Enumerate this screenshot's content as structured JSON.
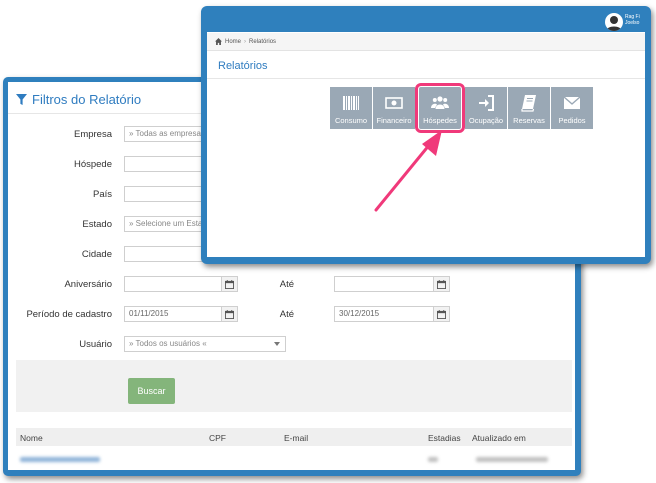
{
  "filters": {
    "title": "Filtros do Relatório",
    "fields": {
      "empresa": {
        "label": "Empresa",
        "value": "» Todas as empresas"
      },
      "hospede": {
        "label": "Hóspede",
        "value": ""
      },
      "pais": {
        "label": "País",
        "value": ""
      },
      "estado": {
        "label": "Estado",
        "value": "» Selecione um Esta"
      },
      "cidade": {
        "label": "Cidade",
        "value": ""
      },
      "aniversario": {
        "label": "Aniversário",
        "value": "",
        "ate_label": "Até",
        "ate_value": ""
      },
      "periodo": {
        "label": "Período de cadastro",
        "value": "01/11/2015",
        "ate_label": "Até",
        "ate_value": "30/12/2015"
      },
      "usuario": {
        "label": "Usuário",
        "value": "» Todos os usuários «"
      }
    },
    "search_button": "Buscar"
  },
  "table": {
    "columns": [
      "Nome",
      "CPF",
      "E-mail",
      "Estadias",
      "Atualizado em"
    ]
  },
  "reports": {
    "user_name_line1": "Rag Fi",
    "user_name_line2": "Joelso",
    "breadcrumb": {
      "home": "Home",
      "current": "Relatórios"
    },
    "title": "Relatórios",
    "tiles": [
      {
        "label": "Consumo",
        "icon": "barcode-icon"
      },
      {
        "label": "Financeiro",
        "icon": "money-icon"
      },
      {
        "label": "Hóspedes",
        "icon": "users-icon",
        "active": true
      },
      {
        "label": "Ocupação",
        "icon": "sign-in-icon"
      },
      {
        "label": "Reservas",
        "icon": "book-icon"
      },
      {
        "label": "Pedidos",
        "icon": "envelope-icon"
      }
    ]
  },
  "colors": {
    "frame_blue": "#2f80bd",
    "tile_gray": "#9aa8b5",
    "highlight_pink": "#f0397a",
    "button_green": "#84b57b"
  }
}
